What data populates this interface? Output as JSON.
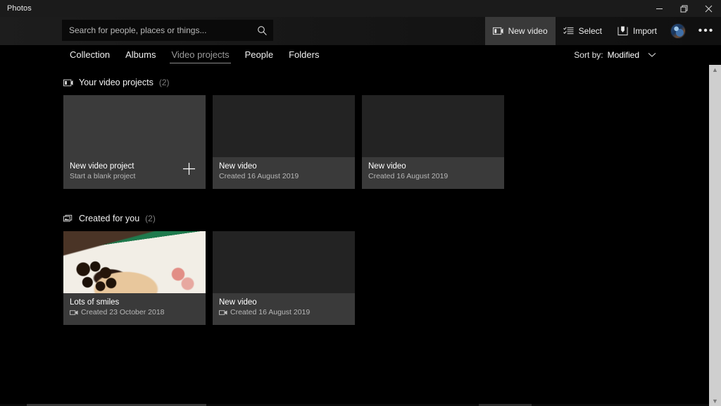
{
  "window": {
    "app_title": "Photos",
    "caption": {
      "minimize": "minimize-icon",
      "restore": "restore-icon",
      "close": "close-icon"
    }
  },
  "search": {
    "placeholder": "Search for people, places or things...",
    "value": "",
    "icon": "search-icon"
  },
  "toolbar": {
    "items": [
      {
        "label": "New video",
        "icon": "video-project-icon",
        "active": true
      },
      {
        "label": "Select",
        "icon": "checklist-icon",
        "active": false
      },
      {
        "label": "Import",
        "icon": "import-icon",
        "active": false
      }
    ],
    "avatar": "user-avatar",
    "more_label": "•••"
  },
  "nav": {
    "tabs": [
      {
        "label": "Collection",
        "active": false
      },
      {
        "label": "Albums",
        "active": false
      },
      {
        "label": "Video projects",
        "active": true
      },
      {
        "label": "People",
        "active": false
      },
      {
        "label": "Folders",
        "active": false
      }
    ]
  },
  "sort": {
    "label": "Sort by:",
    "value": "Modified",
    "chevron": "chevron-down-icon"
  },
  "sections": [
    {
      "title": "Your video projects",
      "count": "(2)",
      "icon": "video-project-icon",
      "cards": [
        {
          "kind": "blank",
          "title": "New video project",
          "subtitle": "Start a blank project",
          "has_cam_icon": false,
          "action_icon": "plus-icon"
        },
        {
          "kind": "dark",
          "title": "New video",
          "subtitle": "Created 16 August 2019",
          "has_cam_icon": false
        },
        {
          "kind": "dark",
          "title": "New video",
          "subtitle": "Created 16 August 2019",
          "has_cam_icon": false
        }
      ]
    },
    {
      "title": "Created for you",
      "count": "(2)",
      "icon": "photo-stack-icon",
      "cards": [
        {
          "kind": "photo",
          "title": "Lots of smiles",
          "subtitle": "Created 23 October 2018",
          "has_cam_icon": true
        },
        {
          "kind": "dark",
          "title": "New video",
          "subtitle": "Created 16 August 2019",
          "has_cam_icon": true
        }
      ]
    }
  ],
  "scrollbars": {
    "vertical_up": "▲",
    "vertical_down": "▼"
  },
  "colors": {
    "window_bg": "#000000",
    "titlebar": "#1b1b1b",
    "card_footer": "#3a3a3a",
    "card_dark": "#232323",
    "accent_text": "#ffffff",
    "muted_text": "#b7b7b7",
    "scrollbar": "#cfcfcf"
  }
}
